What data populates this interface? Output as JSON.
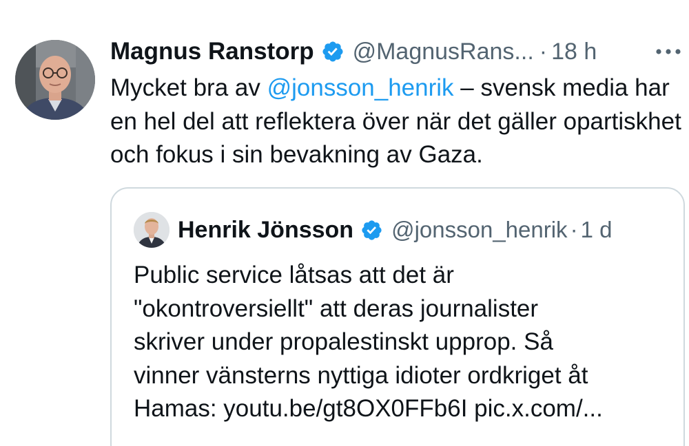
{
  "tweet": {
    "author": {
      "name": "Magnus Ranstorp",
      "handle": "@MagnusRans...",
      "verified": true
    },
    "separator": "·",
    "time": "18 h",
    "more_label": "···",
    "text": {
      "before_mention": "Mycket bra av ",
      "mention": "@jonsson_henrik",
      "after_mention": " – svensk media har en hel del att reflektera över när det gäller opartiskhet och fokus i sin bevakning av Gaza."
    }
  },
  "quote": {
    "author": {
      "name": "Henrik Jönsson",
      "handle": "@jonsson_henrik",
      "verified": true
    },
    "separator": "·",
    "time": "1 d",
    "lines": [
      "Public service låtsas att det är",
      "\"okontroversiellt\" att deras journalister",
      "skriver under propalestinskt upprop. Så",
      "vinner vänsterns nyttiga idioter ordkriget åt",
      "Hamas: youtu.be/gt8OX0FFb6I pic.x.com/..."
    ]
  },
  "colors": {
    "link": "#1d9bf0",
    "verified_badge": "#1d9bf0",
    "secondary_text": "#536471",
    "border": "#cfd9de"
  },
  "icons": {
    "verified": "verified-badge-icon",
    "more": "more-options-icon"
  }
}
